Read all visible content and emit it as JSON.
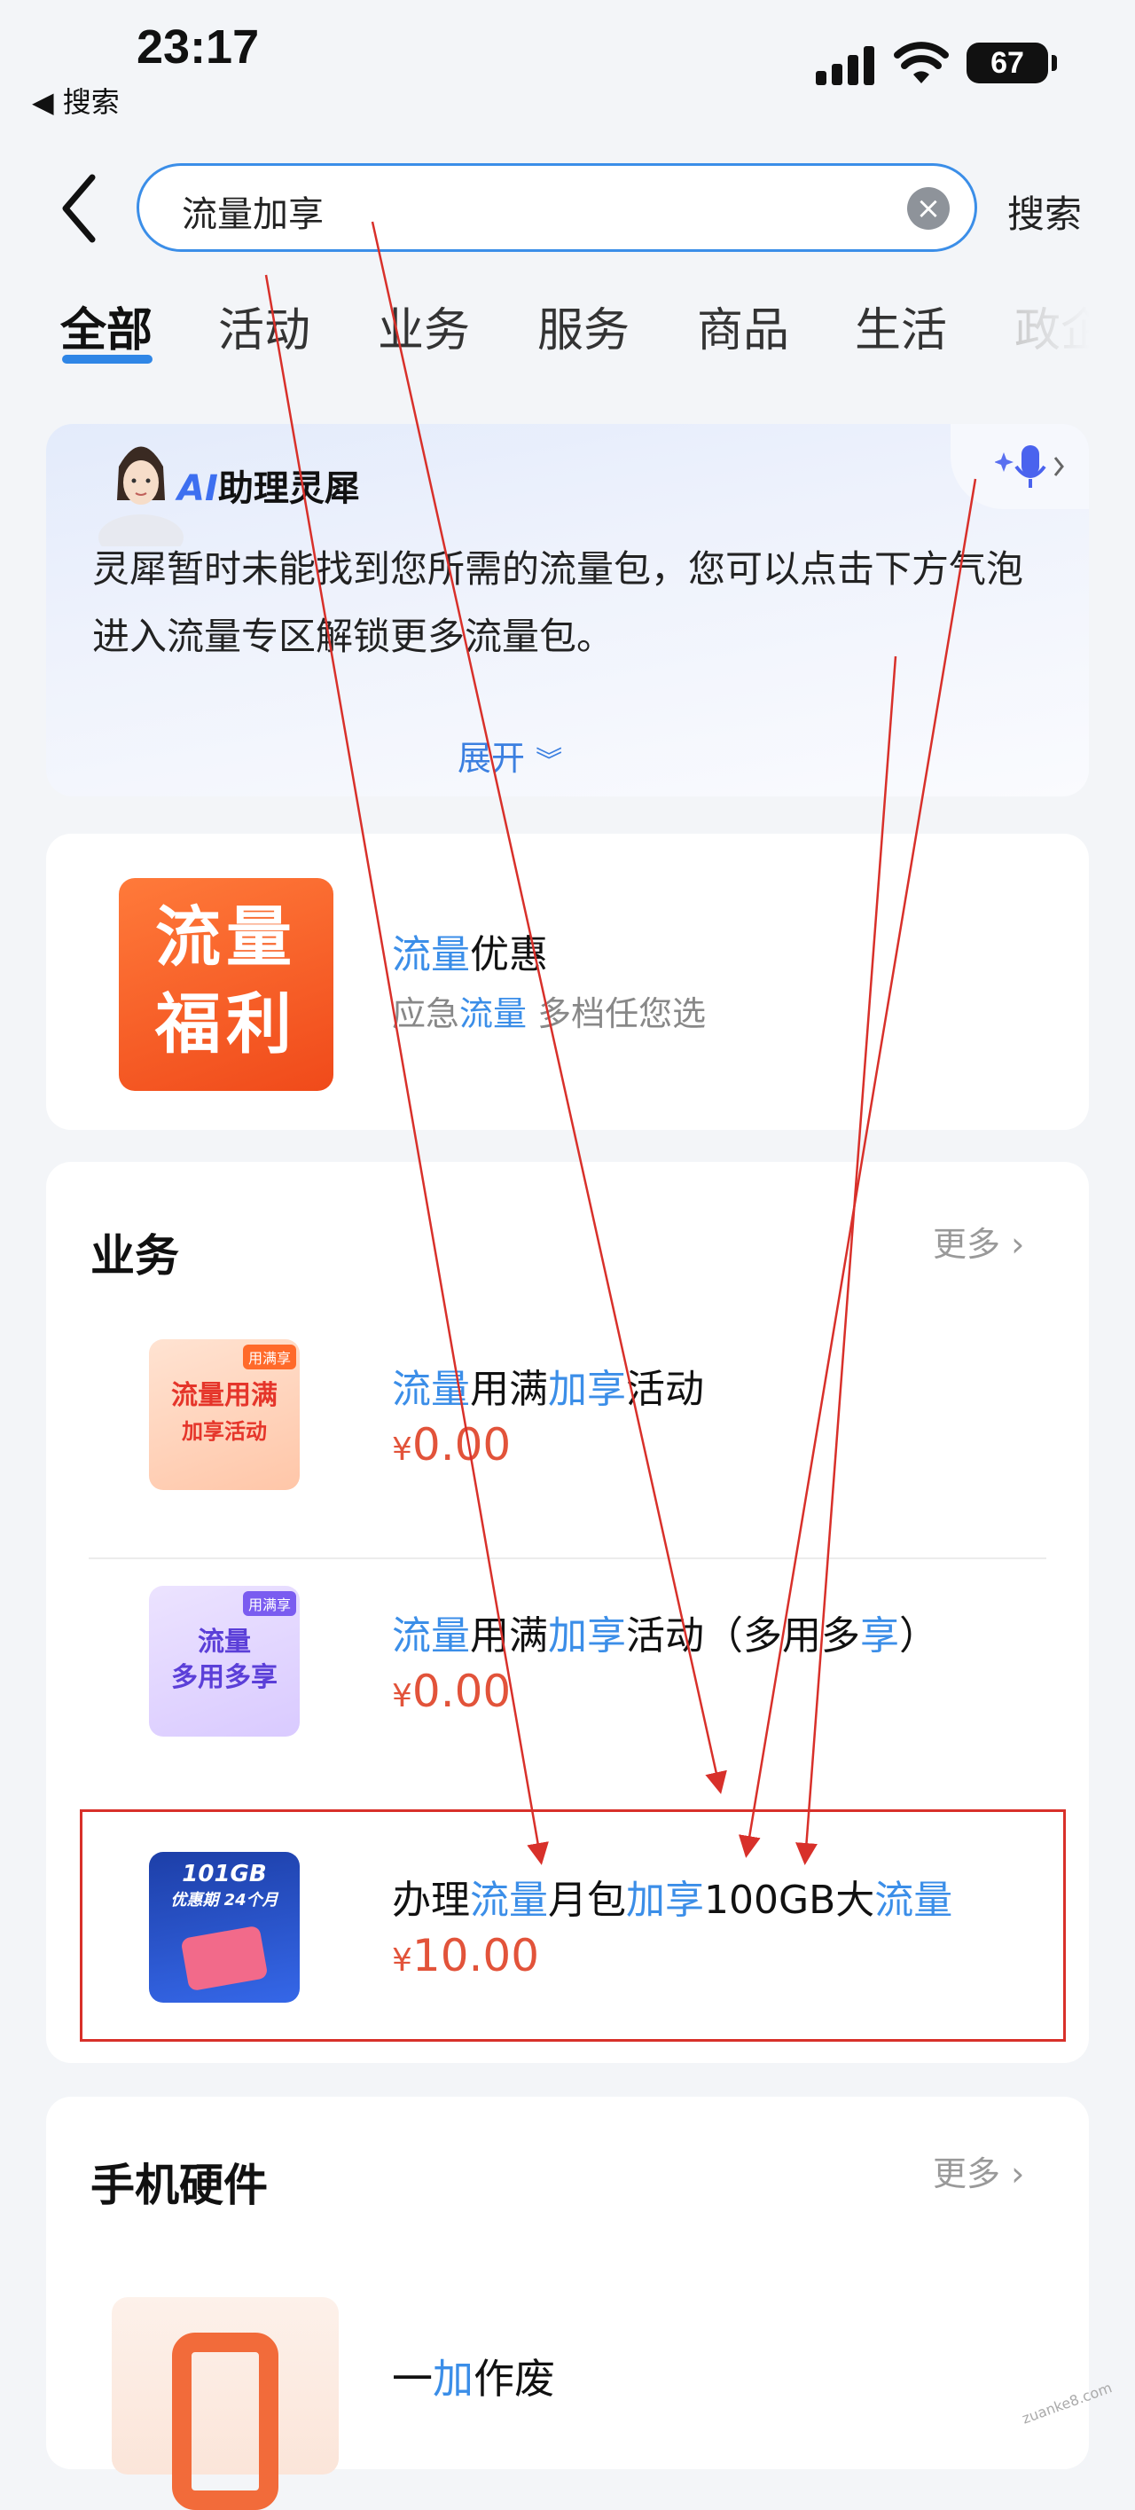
{
  "status_bar": {
    "time": "23:17",
    "back_app": "◀ 搜索",
    "battery": "67"
  },
  "search": {
    "value": "流量加享",
    "button": "搜索"
  },
  "tabs": [
    "全部",
    "活动",
    "业务",
    "服务",
    "商品",
    "生活",
    "政企"
  ],
  "ai_card": {
    "title_ai": "AI",
    "title_rest": "助理灵犀",
    "message": "灵犀暂时未能找到您所需的流量包，您可以点击下方气泡进入流量专区解锁更多流量包。",
    "expand": "展开"
  },
  "promo": {
    "image_text_line1": "流量",
    "image_text_line2": "福利",
    "title_hl": "流量",
    "title_rest": "优惠",
    "sub_a": "应急",
    "sub_hl": "流量",
    "sub_b": " 多档任您选"
  },
  "business": {
    "title": "业务",
    "more": "更多",
    "items": [
      {
        "thumb_badge": "用满享",
        "thumb_line1": "流量用满",
        "thumb_line2": "加享活动",
        "t1": "流量",
        "t2": "用满",
        "t3": "加享",
        "t4": "活动",
        "t5": "",
        "t6": "",
        "t7": "",
        "price_symbol": "¥",
        "price": "0.00"
      },
      {
        "thumb_badge": "用满享",
        "thumb_line1": "流量",
        "thumb_line2": "多用多享",
        "t1": "流量",
        "t2": "用满",
        "t3": "加享",
        "t4": "活动（多用多",
        "t5": "享",
        "t6": "）",
        "t7": "",
        "price_symbol": "¥",
        "price": "0.00"
      },
      {
        "thumb_line1": "101GB",
        "thumb_line2": "优惠期 24个月",
        "t1": "办理",
        "t2": "流量",
        "t3": "月包",
        "t4": "加享",
        "t5": "100GB大",
        "t6": "流量",
        "t7": "",
        "price_symbol": "¥",
        "price": "10.00"
      }
    ]
  },
  "hardware": {
    "title": "手机硬件",
    "more": "更多",
    "item_a": "一",
    "item_hl": "加",
    "item_b": "作废"
  },
  "watermark": "zuanke8.com",
  "colors": {
    "accent": "#3b8ee8",
    "price": "#e2533a",
    "annotation_red": "#d8302a"
  }
}
